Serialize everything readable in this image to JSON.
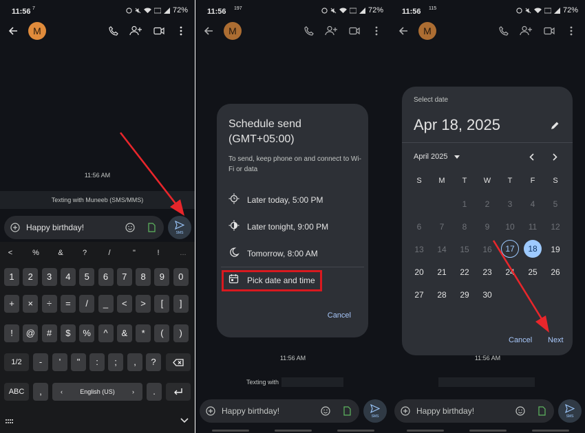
{
  "status": {
    "p1_time": "11:56",
    "p1_note": "7",
    "p2_time": "11:56",
    "p2_note": "197",
    "p3_time": "11:56",
    "p3_note": "115",
    "battery": "72%"
  },
  "contact": {
    "initial": "M"
  },
  "conversation": {
    "timestamp": "11:56 AM",
    "texting_full": "Texting with Muneeb (SMS/MMS)",
    "texting_short": "Texting with",
    "draft": "Happy birthday!",
    "send_label": "SMS"
  },
  "keyboard": {
    "symbols": [
      "<",
      "%",
      "&",
      "?",
      "/",
      "\"",
      "!",
      "..."
    ],
    "row1": [
      "1",
      "2",
      "3",
      "4",
      "5",
      "6",
      "7",
      "8",
      "9",
      "0"
    ],
    "row2": [
      "+",
      "×",
      "÷",
      "=",
      "/",
      "_",
      "<",
      ">",
      "[",
      "]"
    ],
    "row3": [
      "!",
      "@",
      "#",
      "$",
      "%",
      "^",
      "&",
      "*",
      "(",
      ")"
    ],
    "row4": [
      "1/2",
      "-",
      "'",
      "\"",
      ":",
      ";",
      ",",
      "?"
    ],
    "abc": "ABC",
    "comma": ",",
    "language": "English (US)",
    "period": "."
  },
  "schedule": {
    "title": "Schedule send",
    "timezone": "(GMT+05:00)",
    "subtitle": "To send, keep phone on and connect to Wi-Fi or data",
    "options": [
      "Later today, 5:00 PM",
      "Later tonight, 9:00 PM",
      "Tomorrow, 8:00 AM"
    ],
    "pick": "Pick date and time",
    "cancel": "Cancel"
  },
  "calendar": {
    "heading": "Select date",
    "selected": "Apr 18, 2025",
    "month": "April 2025",
    "weekdays": [
      "S",
      "M",
      "T",
      "W",
      "T",
      "F",
      "S"
    ],
    "weeks": [
      [
        "",
        "",
        "1",
        "2",
        "3",
        "4",
        "5"
      ],
      [
        "6",
        "7",
        "8",
        "9",
        "10",
        "11",
        "12"
      ],
      [
        "13",
        "14",
        "15",
        "16",
        "17",
        "18",
        "19"
      ],
      [
        "20",
        "21",
        "22",
        "23",
        "24",
        "25",
        "26"
      ],
      [
        "27",
        "28",
        "29",
        "30",
        "",
        "",
        ""
      ]
    ],
    "today": "17",
    "selected_day": "18",
    "cancel": "Cancel",
    "next": "Next"
  },
  "colors": {
    "background": "#111318",
    "accent": "#a8c7fa",
    "highlight": "#d9191f",
    "avatar": "#e08b3b"
  }
}
